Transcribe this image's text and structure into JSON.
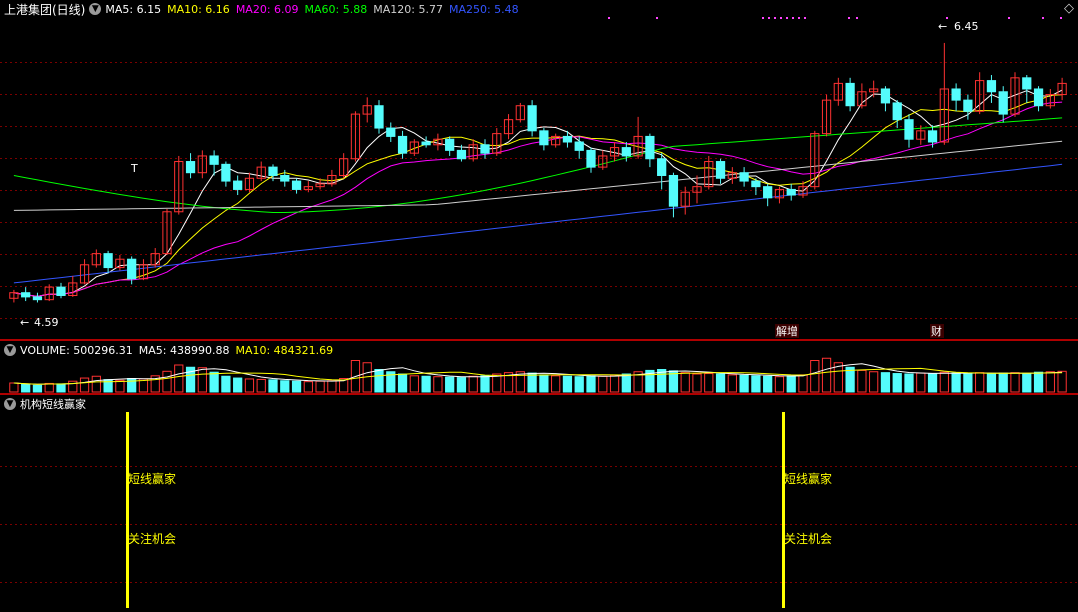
{
  "main_header": {
    "title": "上港集团(日线)",
    "ma_items": [
      {
        "label": "MA5: 6.15",
        "color": "#ffffff"
      },
      {
        "label": "MA10: 6.16",
        "color": "#ffff00"
      },
      {
        "label": "MA20: 6.09",
        "color": "#ff00ff"
      },
      {
        "label": "MA60: 5.88",
        "color": "#00ff00"
      },
      {
        "label": "MA120: 5.77",
        "color": "#cfcfcf"
      },
      {
        "label": "MA250: 5.48",
        "color": "#3355ff"
      }
    ]
  },
  "annotations": {
    "low_price": "4.59",
    "high_price": "6.45",
    "t_marker": "T",
    "event_tag_1": "解增",
    "event_tag_2": "财"
  },
  "volume_header": {
    "label": "VOLUME: 500296.31",
    "ma5": "MA5: 438990.88",
    "ma10": "MA10: 484321.69"
  },
  "indicator_header": {
    "title": "机构短线赢家"
  },
  "signals": [
    {
      "line1": "短线赢家",
      "line2": "关注机会"
    },
    {
      "line1": "短线赢家",
      "line2": "关注机会"
    }
  ],
  "colors": {
    "up": "#ff3232",
    "down": "#54fcfc",
    "grid": "#7a0000",
    "border": "#b00000",
    "ma5": "#ffffff",
    "ma10": "#ffff00",
    "ma20": "#ff00ff",
    "ma60": "#00ff00",
    "ma120": "#cfcfcf",
    "ma250": "#3355ff",
    "signal": "#ffff00"
  },
  "chart_data": {
    "type": "candlestick",
    "y_range": [
      4.45,
      6.6
    ],
    "candles": [
      [
        4.62,
        4.66,
        4.59,
        4.68
      ],
      [
        4.66,
        4.63,
        4.6,
        4.7
      ],
      [
        4.63,
        4.61,
        4.59,
        4.66
      ],
      [
        4.61,
        4.7,
        4.6,
        4.72
      ],
      [
        4.7,
        4.64,
        4.62,
        4.73
      ],
      [
        4.64,
        4.73,
        4.63,
        4.78
      ],
      [
        4.73,
        4.86,
        4.72,
        4.9
      ],
      [
        4.86,
        4.94,
        4.84,
        4.97
      ],
      [
        4.94,
        4.84,
        4.8,
        4.96
      ],
      [
        4.84,
        4.9,
        4.82,
        4.93
      ],
      [
        4.9,
        4.76,
        4.72,
        4.92
      ],
      [
        4.76,
        4.86,
        4.75,
        4.9
      ],
      [
        4.86,
        4.94,
        4.84,
        4.98
      ],
      [
        4.94,
        5.24,
        4.93,
        5.26
      ],
      [
        5.24,
        5.6,
        5.22,
        5.64
      ],
      [
        5.6,
        5.52,
        5.48,
        5.66
      ],
      [
        5.52,
        5.64,
        5.48,
        5.68
      ],
      [
        5.64,
        5.58,
        5.5,
        5.68
      ],
      [
        5.58,
        5.46,
        5.42,
        5.6
      ],
      [
        5.46,
        5.4,
        5.36,
        5.5
      ],
      [
        5.4,
        5.48,
        5.38,
        5.52
      ],
      [
        5.48,
        5.56,
        5.46,
        5.6
      ],
      [
        5.56,
        5.5,
        5.46,
        5.58
      ],
      [
        5.5,
        5.46,
        5.42,
        5.54
      ],
      [
        5.46,
        5.4,
        5.37,
        5.48
      ],
      [
        5.4,
        5.42,
        5.38,
        5.46
      ],
      [
        5.42,
        5.44,
        5.4,
        5.48
      ],
      [
        5.44,
        5.5,
        5.42,
        5.54
      ],
      [
        5.5,
        5.62,
        5.48,
        5.66
      ],
      [
        5.62,
        5.94,
        5.6,
        5.96
      ],
      [
        5.94,
        6.0,
        5.88,
        6.06
      ],
      [
        6.0,
        5.84,
        5.8,
        6.04
      ],
      [
        5.84,
        5.78,
        5.74,
        5.88
      ],
      [
        5.78,
        5.66,
        5.62,
        5.82
      ],
      [
        5.66,
        5.74,
        5.64,
        5.76
      ],
      [
        5.74,
        5.72,
        5.7,
        5.78
      ],
      [
        5.72,
        5.76,
        5.68,
        5.8
      ],
      [
        5.76,
        5.68,
        5.64,
        5.78
      ],
      [
        5.68,
        5.62,
        5.6,
        5.72
      ],
      [
        5.62,
        5.72,
        5.6,
        5.76
      ],
      [
        5.72,
        5.66,
        5.62,
        5.76
      ],
      [
        5.66,
        5.8,
        5.64,
        5.84
      ],
      [
        5.8,
        5.9,
        5.76,
        5.94
      ],
      [
        5.9,
        6.0,
        5.88,
        6.02
      ],
      [
        6.0,
        5.82,
        5.78,
        6.04
      ],
      [
        5.82,
        5.72,
        5.68,
        5.84
      ],
      [
        5.72,
        5.78,
        5.7,
        5.8
      ],
      [
        5.78,
        5.74,
        5.7,
        5.82
      ],
      [
        5.74,
        5.68,
        5.62,
        5.78
      ],
      [
        5.68,
        5.56,
        5.52,
        5.7
      ],
      [
        5.56,
        5.64,
        5.54,
        5.68
      ],
      [
        5.64,
        5.7,
        5.6,
        5.74
      ],
      [
        5.7,
        5.64,
        5.6,
        5.74
      ],
      [
        5.64,
        5.78,
        5.62,
        5.92
      ],
      [
        5.78,
        5.62,
        5.56,
        5.8
      ],
      [
        5.62,
        5.5,
        5.4,
        5.66
      ],
      [
        5.5,
        5.28,
        5.2,
        5.52
      ],
      [
        5.28,
        5.38,
        5.22,
        5.42
      ],
      [
        5.38,
        5.42,
        5.3,
        5.5
      ],
      [
        5.42,
        5.6,
        5.4,
        5.64
      ],
      [
        5.6,
        5.48,
        5.44,
        5.62
      ],
      [
        5.48,
        5.52,
        5.44,
        5.56
      ],
      [
        5.52,
        5.46,
        5.42,
        5.56
      ],
      [
        5.46,
        5.42,
        5.36,
        5.48
      ],
      [
        5.42,
        5.34,
        5.28,
        5.44
      ],
      [
        5.34,
        5.4,
        5.3,
        5.42
      ],
      [
        5.4,
        5.36,
        5.32,
        5.44
      ],
      [
        5.36,
        5.42,
        5.34,
        5.46
      ],
      [
        5.42,
        5.8,
        5.4,
        5.82
      ],
      [
        5.8,
        6.04,
        5.78,
        6.08
      ],
      [
        6.04,
        6.16,
        6.0,
        6.2
      ],
      [
        6.16,
        6.0,
        5.96,
        6.2
      ],
      [
        6.0,
        6.1,
        5.98,
        6.16
      ],
      [
        6.1,
        6.12,
        6.06,
        6.18
      ],
      [
        6.12,
        6.02,
        5.96,
        6.14
      ],
      [
        6.02,
        5.9,
        5.84,
        6.04
      ],
      [
        5.9,
        5.76,
        5.7,
        5.94
      ],
      [
        5.76,
        5.82,
        5.72,
        5.86
      ],
      [
        5.82,
        5.74,
        5.7,
        5.86
      ],
      [
        5.74,
        6.12,
        5.72,
        6.45
      ],
      [
        6.12,
        6.04,
        5.96,
        6.16
      ],
      [
        6.04,
        5.96,
        5.9,
        6.08
      ],
      [
        5.96,
        6.18,
        5.94,
        6.24
      ],
      [
        6.18,
        6.1,
        6.02,
        6.22
      ],
      [
        6.1,
        5.94,
        5.88,
        6.14
      ],
      [
        5.94,
        6.2,
        5.92,
        6.24
      ],
      [
        6.2,
        6.12,
        6.02,
        6.22
      ],
      [
        6.12,
        6.0,
        5.96,
        6.14
      ],
      [
        6.0,
        6.08,
        5.98,
        6.12
      ],
      [
        6.08,
        6.16,
        6.04,
        6.2
      ]
    ],
    "volume": [
      40,
      34,
      30,
      38,
      36,
      48,
      62,
      70,
      55,
      52,
      60,
      58,
      72,
      92,
      120,
      110,
      108,
      88,
      70,
      62,
      58,
      56,
      54,
      50,
      48,
      46,
      48,
      50,
      60,
      140,
      130,
      100,
      90,
      80,
      72,
      70,
      68,
      66,
      64,
      70,
      72,
      80,
      86,
      90,
      84,
      76,
      72,
      70,
      68,
      72,
      70,
      74,
      80,
      90,
      96,
      100,
      94,
      86,
      80,
      82,
      80,
      76,
      74,
      72,
      70,
      68,
      72,
      76,
      140,
      150,
      130,
      110,
      96,
      90,
      86,
      82,
      80,
      84,
      82,
      88,
      84,
      82,
      86,
      80,
      84,
      86,
      82,
      88,
      90,
      92
    ],
    "volume_range": [
      0,
      160
    ]
  }
}
